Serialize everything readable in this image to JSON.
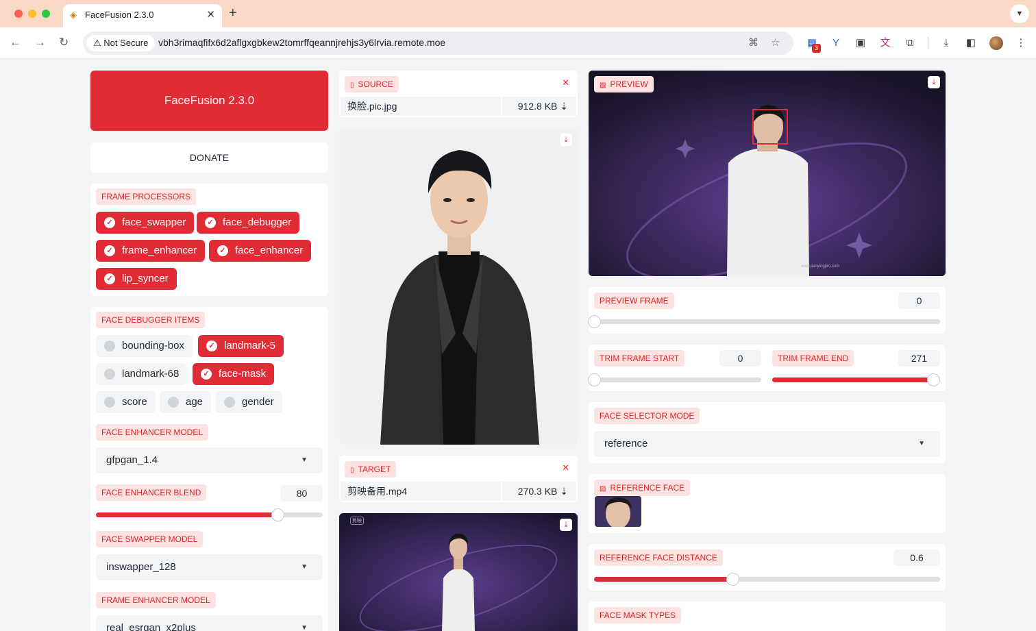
{
  "browser": {
    "tab_title": "FaceFusion 2.3.0",
    "tab_favicon": "facefusion-icon",
    "new_tab_label": "+",
    "security_label": "Not Secure",
    "url": "vbh3rimaqfifx6d2aflgxgbkew2tomrffqeannjrehjs3y6lrvia.remote.moe",
    "extension_badge": "3"
  },
  "header": {
    "title": "FaceFusion 2.3.0",
    "donate_label": "DONATE"
  },
  "frame_processors": {
    "label": "FRAME PROCESSORS",
    "items": [
      {
        "name": "face_swapper",
        "checked": true
      },
      {
        "name": "face_debugger",
        "checked": true
      },
      {
        "name": "frame_enhancer",
        "checked": true
      },
      {
        "name": "face_enhancer",
        "checked": true
      },
      {
        "name": "lip_syncer",
        "checked": true
      }
    ]
  },
  "face_debugger_items": {
    "label": "FACE DEBUGGER ITEMS",
    "items": [
      {
        "name": "bounding-box",
        "checked": false
      },
      {
        "name": "landmark-5",
        "checked": true
      },
      {
        "name": "landmark-68",
        "checked": false
      },
      {
        "name": "face-mask",
        "checked": true
      },
      {
        "name": "score",
        "checked": false
      },
      {
        "name": "age",
        "checked": false
      },
      {
        "name": "gender",
        "checked": false
      }
    ]
  },
  "face_enhancer_model": {
    "label": "FACE ENHANCER MODEL",
    "value": "gfpgan_1.4"
  },
  "face_enhancer_blend": {
    "label": "FACE ENHANCER BLEND",
    "value": "80",
    "fraction": 0.8
  },
  "face_swapper_model": {
    "label": "FACE SWAPPER MODEL",
    "value": "inswapper_128"
  },
  "frame_enhancer_model": {
    "label": "FRAME ENHANCER MODEL",
    "value": "real_esrgan_x2plus"
  },
  "source": {
    "label": "SOURCE",
    "file_name": "换脸.pic.jpg",
    "file_size": "912.8 KB ⇣"
  },
  "target": {
    "label": "TARGET",
    "file_name": "剪映备用.mp4",
    "file_size": "270.3 KB ⇣",
    "watermark": "剪映"
  },
  "preview": {
    "label": "PREVIEW",
    "footer_text": "www.jianyingpro.com"
  },
  "preview_frame": {
    "label": "PREVIEW FRAME",
    "value": "0",
    "fraction": 0
  },
  "trim_frame_start": {
    "label": "TRIM FRAME START",
    "value": "0",
    "fraction": 0
  },
  "trim_frame_end": {
    "label": "TRIM FRAME END",
    "value": "271",
    "fraction": 1
  },
  "face_selector_mode": {
    "label": "FACE SELECTOR MODE",
    "value": "reference"
  },
  "reference_face": {
    "label": "REFERENCE FACE"
  },
  "reference_face_distance": {
    "label": "REFERENCE FACE DISTANCE",
    "value": "0.6",
    "fraction": 0.4
  },
  "face_mask_types": {
    "label": "FACE MASK TYPES"
  },
  "colors": {
    "accent": "#e02d35",
    "label_bg": "#fde2e2",
    "page_bg": "#f3f4f6",
    "video_bg": "#2a1f4a"
  }
}
